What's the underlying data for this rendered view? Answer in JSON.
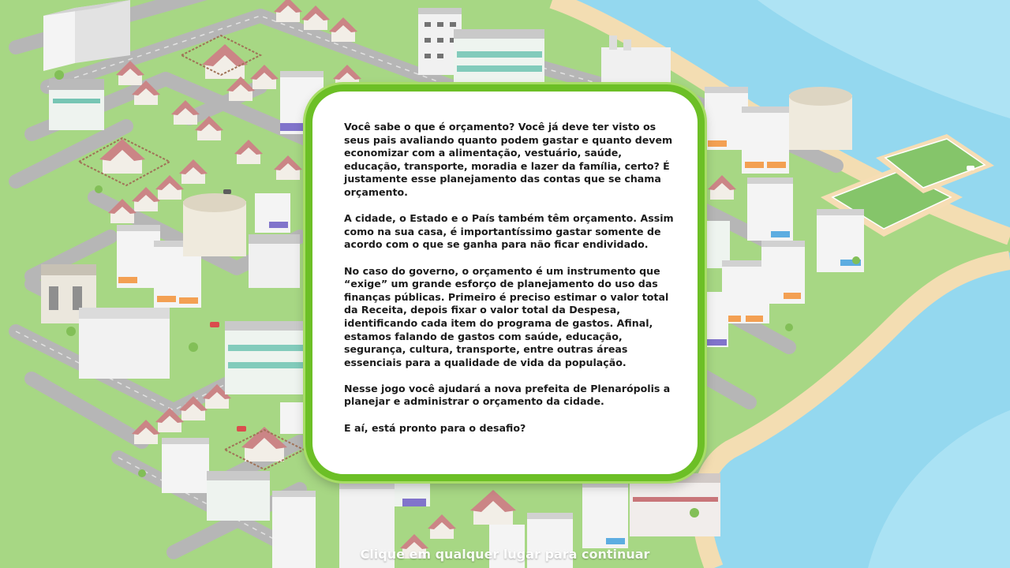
{
  "intro": {
    "paragraphs": [
      "Você sabe o que é orçamento? Você já deve ter visto os seus pais avaliando quanto podem gastar e quanto devem economizar com a alimentação, vestuário, saúde, educação, transporte, moradia e lazer da família, certo? É justamente esse planejamento das contas que se chama orçamento.",
      "A cidade, o Estado e o País também têm orçamento. Assim como na sua casa, é importantíssimo gastar somente de acordo com o que se ganha para não ficar endividado.",
      "No caso do governo, o orçamento é um instrumento que “exige” um grande esforço de planejamento do uso das finanças públicas. Primeiro é preciso estimar o valor total da Receita, depois fixar o valor total da Despesa, identificando cada item do programa de gastos. Afinal, estamos falando de gastos com saúde, educação, segurança, cultura, transporte, entre outras áreas essenciais para a qualidade de vida da população.",
      "Nesse jogo você ajudará a nova prefeita de Plenarópolis a planejar e administrar o orçamento da cidade.",
      "E aí, está pronto para o desafio?"
    ]
  },
  "continue_hint": "Clique em qualquer lugar para continuar",
  "colors": {
    "grass": "#9fd27a",
    "sea": "#8fd6ef",
    "sand": "#f3dcae",
    "road": "#b3b3b3",
    "dialog_border": "#6cbf26"
  }
}
